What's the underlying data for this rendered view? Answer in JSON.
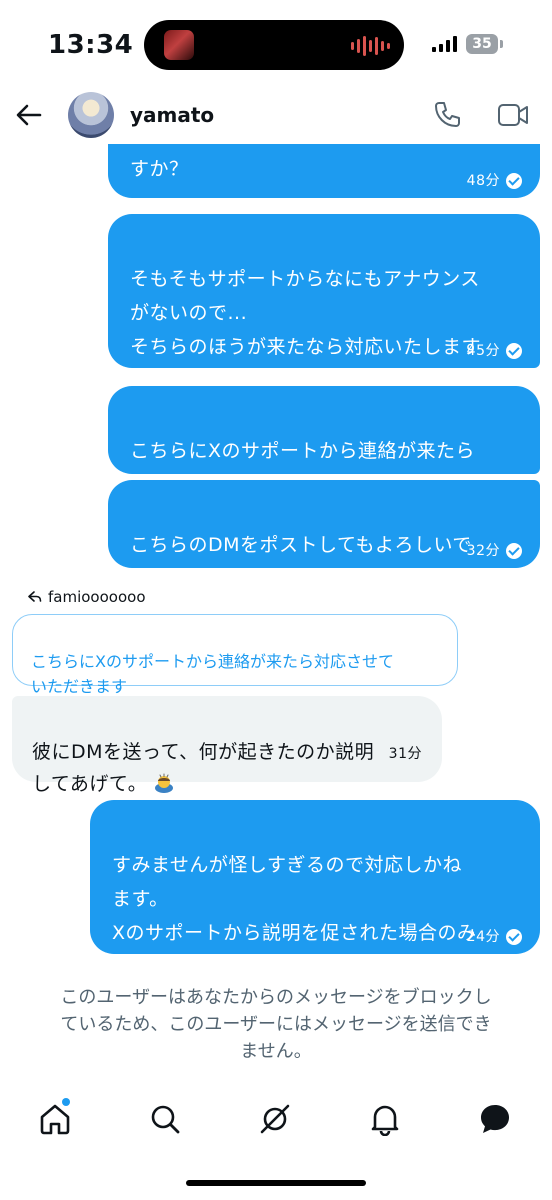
{
  "status": {
    "time": "13:34",
    "battery": "35"
  },
  "header": {
    "username": "yamato"
  },
  "messages": {
    "m1": {
      "text": "すか？",
      "time": "48分"
    },
    "m2": {
      "text": "そもそもサポートからなにもアナウンス\nがないので...\nそちらのほうが来たなら対応いたします\nが...",
      "time": "45分"
    },
    "m3": {
      "text": "こちらにXのサポートから連絡が来たら\n対応させていただきます"
    },
    "m4": {
      "text": "こちらのDMをポストしてもよろしいで\nしょうか？",
      "time": "32分"
    },
    "reply_to": "famiooooooo",
    "quoted": "こちらにXのサポートから連絡が来たら対応させて\nいただきます",
    "incoming": {
      "text": "彼にDMを送って、何が起きたのか説明\nしてあげて。",
      "time": "31分"
    },
    "m5": {
      "text": "すみませんが怪しすぎるので対応しかね\nます。\nXのサポートから説明を促された場合のみ\n対応させていただきます",
      "time": "24分"
    }
  },
  "notice": "このユーザーはあなたからのメッセージをブロックし\nているため、このユーザーにはメッセージを送信でき\nません。",
  "icons": {
    "back": "arrow-left-icon",
    "call": "phone-icon",
    "video": "video-icon",
    "tabs": [
      "home-icon",
      "search-icon",
      "grok-icon",
      "bell-icon",
      "messages-icon"
    ]
  },
  "colors": {
    "accent": "#1d9bf0",
    "incoming_bg": "#eff3f4",
    "muted": "#536471"
  }
}
